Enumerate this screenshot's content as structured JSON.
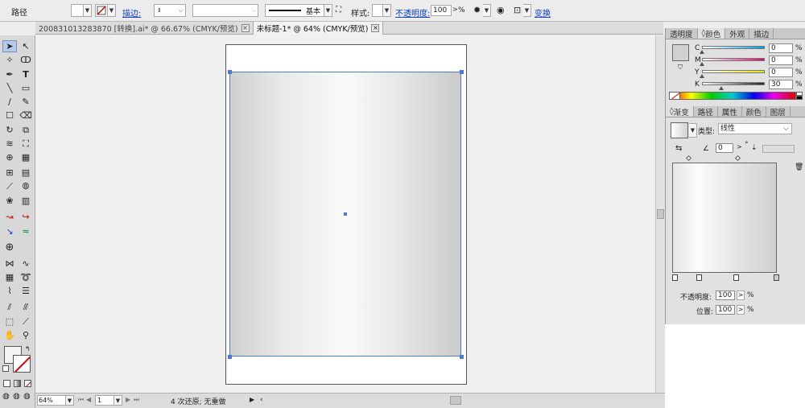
{
  "control_bar": {
    "object_type": "路径",
    "stroke_link": "描边:",
    "stroke_profile": "基本",
    "style_label": "样式:",
    "opacity_link": "不透明度:",
    "opacity_value": "100",
    "percent": "%",
    "transform_link": "变换"
  },
  "doc_tabs": [
    {
      "label": "200831013283870  [转换].ai* @ 66.67% (CMYK/预览)",
      "close": "×"
    },
    {
      "label": "未标题-1* @ 64% (CMYK/预览)",
      "close": "×"
    }
  ],
  "status_bar": {
    "zoom": "64%",
    "page": "1",
    "message": "4 次还原; 无重做"
  },
  "color_panel": {
    "tabs": [
      "透明度",
      "颜色",
      "外观",
      "描边"
    ],
    "active_tab": "颜色",
    "channels": [
      {
        "name": "C",
        "value": "0",
        "color": "#00a0e0"
      },
      {
        "name": "M",
        "value": "0",
        "color": "#e0007a"
      },
      {
        "name": "Y",
        "value": "0",
        "color": "#f0e000"
      },
      {
        "name": "K",
        "value": "30",
        "color": "#222222"
      }
    ],
    "percent": "%",
    "current_color": "#d1d1d1"
  },
  "gradient_panel": {
    "tabs": [
      "渐变",
      "路径",
      "属性",
      "颜色",
      "图层"
    ],
    "active_tab": "渐变",
    "type_label": "类型:",
    "type_value": "线性",
    "angle_value": "0",
    "degree": "°",
    "opacity_label": "不透明度:",
    "opacity_value": "100",
    "location_label": "位置:",
    "location_value": "100",
    "percent": "%"
  },
  "colors": {
    "selection": "#4a78e0",
    "link": "#1340c8"
  }
}
